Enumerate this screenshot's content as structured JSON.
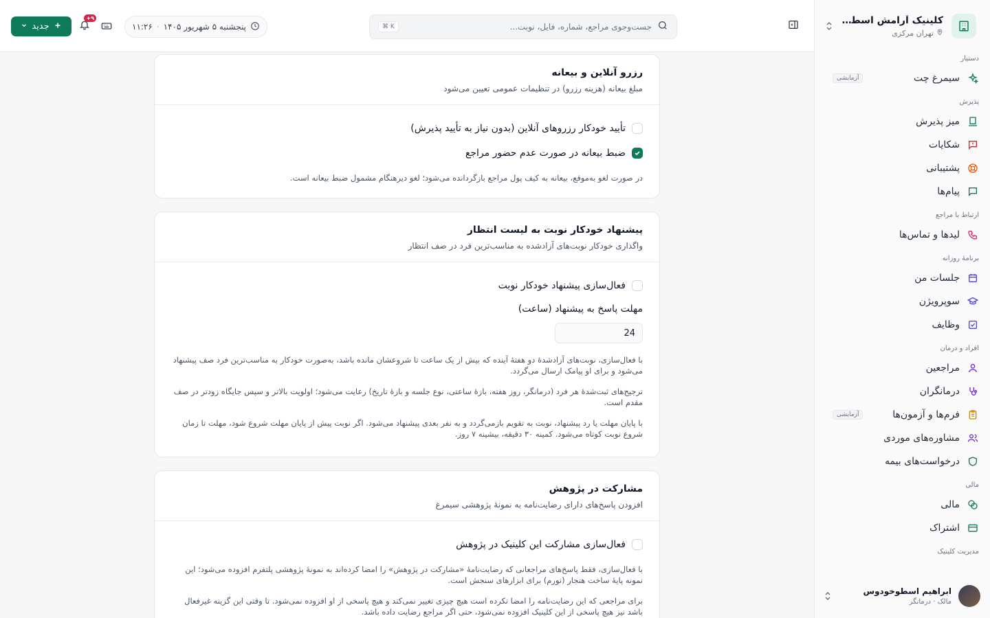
{
  "sidebar": {
    "clinic_name": "کلینیک آرامش اسطوخو...",
    "clinic_location": "تهران مرکزی",
    "sections": [
      {
        "title": "دستیار",
        "items": [
          {
            "label": "سیمرغ چت",
            "badge": "آزمایشی",
            "icon": "sparkle-icon"
          }
        ]
      },
      {
        "title": "پذیرش",
        "items": [
          {
            "label": "میز پذیرش",
            "icon": "desk-icon"
          },
          {
            "label": "شکایات",
            "icon": "complaint-icon"
          },
          {
            "label": "پشتیبانی",
            "icon": "lifebuoy-icon"
          },
          {
            "label": "پیام‌ها",
            "icon": "message-icon"
          }
        ]
      },
      {
        "title": "ارتباط با مراجع",
        "items": [
          {
            "label": "لیدها و تماس‌ها",
            "icon": "phone-icon"
          }
        ]
      },
      {
        "title": "برنامهٔ روزانه",
        "items": [
          {
            "label": "جلسات من",
            "icon": "calendar-icon"
          },
          {
            "label": "سوپرویژن",
            "icon": "graduation-icon"
          },
          {
            "label": "وظایف",
            "icon": "task-icon"
          }
        ]
      },
      {
        "title": "افراد و درمان",
        "items": [
          {
            "label": "مراجعین",
            "icon": "user-icon"
          },
          {
            "label": "درمانگران",
            "icon": "stethoscope-icon"
          },
          {
            "label": "فرم‌ها و آزمون‌ها",
            "badge": "آزمایشی",
            "icon": "clipboard-icon"
          },
          {
            "label": "مشاوره‌های موردی",
            "icon": "users-icon"
          },
          {
            "label": "درخواست‌های بیمه",
            "icon": "shield-icon"
          }
        ]
      },
      {
        "title": "مالی",
        "items": [
          {
            "label": "مالی",
            "icon": "coins-icon"
          },
          {
            "label": "اشتراک",
            "icon": "card-icon"
          }
        ]
      },
      {
        "title": "مدیریت کلینیک",
        "items": []
      }
    ],
    "user": {
      "name": "ابراهیم اسطوخودوس",
      "role": "مالک · درمانگر"
    }
  },
  "topbar": {
    "search_placeholder": "جست‌وجوی مراجع، شماره، فایل، نوبت...",
    "shortcut": "⌘ K",
    "date": "پنجشنبه ۵ شهریور ۱۴۰۵",
    "time": "۱۱:۲۶",
    "notif_count": "۹+",
    "new_label": "جدید"
  },
  "cards": {
    "online": {
      "title": "رزرو آنلاین و بیعانه",
      "desc": "مبلغ بیعانه (هزینه رزرو) در تنظیمات عمومی تعیین می‌شود",
      "opt1": "تأیید خودکار رزروهای آنلاین (بدون نیاز به تأیید پذیرش)",
      "opt1_checked": false,
      "opt2": "ضبط بیعانه در صورت عدم حضور مراجع",
      "opt2_checked": true,
      "note": "در صورت لغو به‌موقع، بیعانه به کیف پول مراجع بازگردانده می‌شود؛ لغو دیرهنگام مشمول ضبط بیعانه است."
    },
    "waitlist": {
      "title": "پیشنهاد خودکار نوبت به لیست انتظار",
      "desc": "واگذاری خودکار نوبت‌های آزادشده به مناسب‌ترین فرد در صف انتظار",
      "opt1": "فعال‌سازی پیشنهاد خودکار نوبت",
      "opt1_checked": false,
      "field_label": "مهلت پاسخ به پیشنهاد (ساعت)",
      "field_value": "24",
      "note1": "با فعال‌سازی، نوبت‌های آزادشدهٔ دو هفتهٔ آینده که بیش از یک ساعت تا شروعشان مانده باشد، به‌صورت خودکار به مناسب‌ترین فرد صف پیشنهاد می‌شود و برای او پیامک ارسال می‌گردد.",
      "note2": "ترجیح‌های ثبت‌شدهٔ هر فرد (درمانگر، روز هفته، بازهٔ ساعتی، نوع جلسه و بازهٔ تاریخ) رعایت می‌شود؛ اولویت بالاتر و سپس جایگاه زودتر در صف مقدم است.",
      "note3": "با پایان مهلت یا رد پیشنهاد، نوبت به تقویم بازمی‌گردد و به نفر بعدی پیشنهاد می‌شود. اگر نوبت پیش از پایان مهلت شروع شود، مهلت تا زمان شروع نوبت کوتاه می‌شود. کمینه ۳۰ دقیقه، بیشینه ۷ روز."
    },
    "research": {
      "title": "مشارکت در پژوهش",
      "desc": "افزودن پاسخ‌های دارای رضایت‌نامه به نمونهٔ پژوهشی سیمرغ",
      "opt1": "فعال‌سازی مشارکت این کلینیک در پژوهش",
      "opt1_checked": false,
      "note1": "با فعال‌سازی، فقط پاسخ‌های مراجعانی که رضایت‌نامهٔ «مشارکت در پژوهش» را امضا کرده‌اند به نمونهٔ پژوهشی پلتفرم افزوده می‌شود؛ این نمونه پایهٔ ساخت هنجار (نورم) برای ابزارهای سنجش است.",
      "note2": "برای مراجعی که این رضایت‌نامه را امضا نکرده است هیچ چیزی تغییر نمی‌کند و هیچ پاسخی از او افزوده نمی‌شود. تا وقتی این گزینه غیرفعال باشد نیز هیچ پاسخی از این کلینیک افزوده نمی‌شود، حتی اگر مراجع رضایت داده باشد."
    }
  },
  "colors": {
    "accent": "#0f7a5a",
    "badge": "#e11d48"
  }
}
